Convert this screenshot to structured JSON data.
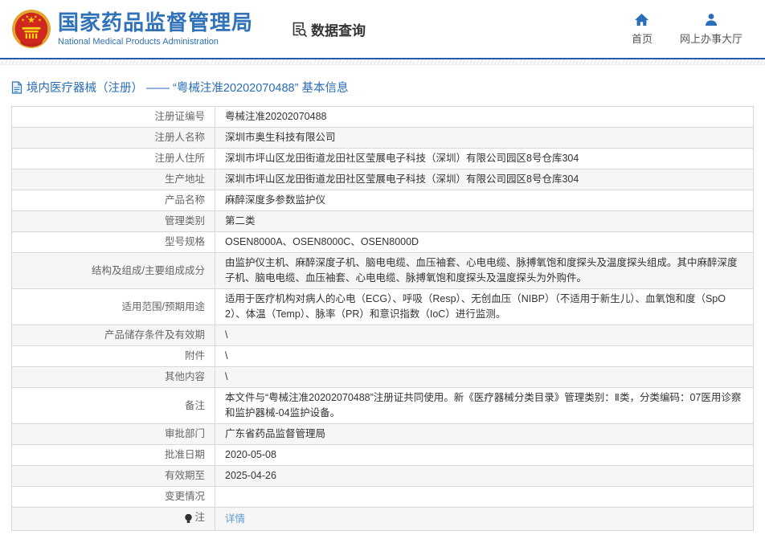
{
  "header": {
    "logo": {
      "title_cn": "国家药品监督管理局",
      "title_en": "National Medical Products Administration"
    },
    "section": {
      "label": "数据查询"
    },
    "nav": [
      {
        "label": "首页",
        "icon": "home-icon"
      },
      {
        "label": "网上办事大厅",
        "icon": "person-icon"
      }
    ]
  },
  "page": {
    "title": "境内医疗器械（注册） —— “粤械注准20202070488” 基本信息"
  },
  "table": {
    "rows": [
      {
        "label": "注册证编号",
        "value": "粤械注准20202070488"
      },
      {
        "label": "注册人名称",
        "value": "深圳市奥生科技有限公司"
      },
      {
        "label": "注册人住所",
        "value": "深圳市坪山区龙田街道龙田社区莹展电子科技（深圳）有限公司园区8号仓库304"
      },
      {
        "label": "生产地址",
        "value": "深圳市坪山区龙田街道龙田社区莹展电子科技（深圳）有限公司园区8号仓库304"
      },
      {
        "label": "产品名称",
        "value": "麻醉深度多参数监护仪"
      },
      {
        "label": "管理类别",
        "value": "第二类"
      },
      {
        "label": "型号规格",
        "value": "OSEN8000A、OSEN8000C、OSEN8000D"
      },
      {
        "label": "结构及组成/主要组成成分",
        "value": "由监护仪主机、麻醉深度子机、脑电电缆、血压袖套、心电电缆、脉搏氧饱和度探头及温度探头组成。其中麻醉深度子机、脑电电缆、血压袖套、心电电缆、脉搏氧饱和度探头及温度探头为外购件。"
      },
      {
        "label": "适用范围/预期用途",
        "value": "适用于医疗机构对病人的心电（ECG）、呼吸（Resp）、无创血压（NIBP）（不适用于新生儿）、血氧饱和度（SpO2）、体温（Temp）、脉率（PR）和意识指数（IoC）进行监测。"
      },
      {
        "label": "产品储存条件及有效期",
        "value": "\\"
      },
      {
        "label": "附件",
        "value": "\\"
      },
      {
        "label": "其他内容",
        "value": "\\"
      },
      {
        "label": "备注",
        "value": "本文件与“粤械注准20202070488”注册证共同使用。新《医疗器械分类目录》管理类别：Ⅱ类，分类编码：07医用诊察和监护器械-04监护设备。"
      },
      {
        "label": "审批部门",
        "value": "广东省药品监督管理局"
      },
      {
        "label": "批准日期",
        "value": "2020-05-08"
      },
      {
        "label": "有效期至",
        "value": "2025-04-26"
      },
      {
        "label": "变更情况",
        "value": ""
      },
      {
        "label": "注",
        "value": "详情",
        "icon": "bulb-icon",
        "value_is_link": true
      }
    ]
  },
  "icons": {
    "emblem": "national-emblem",
    "data_query": "doc-search-icon",
    "home": "home-icon",
    "service_hall": "person-icon",
    "page_title": "document-icon",
    "note": "bulb-icon"
  },
  "colors": {
    "brand_blue": "#2f72b9",
    "nav_blue": "#2a6db8",
    "divider_blue": "#1e5fa8",
    "link_blue": "#5a9ad2",
    "border": "#d8d8d8",
    "alt_row_bg": "#f6f6f6",
    "label_text": "#666666",
    "value_text": "#333333"
  }
}
